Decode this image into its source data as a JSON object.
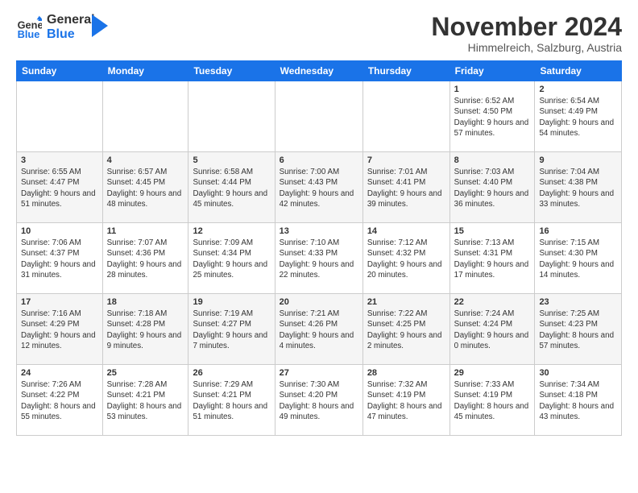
{
  "logo": {
    "line1": "General",
    "line2": "Blue"
  },
  "title": "November 2024",
  "location": "Himmelreich, Salzburg, Austria",
  "weekdays": [
    "Sunday",
    "Monday",
    "Tuesday",
    "Wednesday",
    "Thursday",
    "Friday",
    "Saturday"
  ],
  "weeks": [
    [
      {
        "day": "",
        "info": ""
      },
      {
        "day": "",
        "info": ""
      },
      {
        "day": "",
        "info": ""
      },
      {
        "day": "",
        "info": ""
      },
      {
        "day": "",
        "info": ""
      },
      {
        "day": "1",
        "info": "Sunrise: 6:52 AM\nSunset: 4:50 PM\nDaylight: 9 hours and 57 minutes."
      },
      {
        "day": "2",
        "info": "Sunrise: 6:54 AM\nSunset: 4:49 PM\nDaylight: 9 hours and 54 minutes."
      }
    ],
    [
      {
        "day": "3",
        "info": "Sunrise: 6:55 AM\nSunset: 4:47 PM\nDaylight: 9 hours and 51 minutes."
      },
      {
        "day": "4",
        "info": "Sunrise: 6:57 AM\nSunset: 4:45 PM\nDaylight: 9 hours and 48 minutes."
      },
      {
        "day": "5",
        "info": "Sunrise: 6:58 AM\nSunset: 4:44 PM\nDaylight: 9 hours and 45 minutes."
      },
      {
        "day": "6",
        "info": "Sunrise: 7:00 AM\nSunset: 4:43 PM\nDaylight: 9 hours and 42 minutes."
      },
      {
        "day": "7",
        "info": "Sunrise: 7:01 AM\nSunset: 4:41 PM\nDaylight: 9 hours and 39 minutes."
      },
      {
        "day": "8",
        "info": "Sunrise: 7:03 AM\nSunset: 4:40 PM\nDaylight: 9 hours and 36 minutes."
      },
      {
        "day": "9",
        "info": "Sunrise: 7:04 AM\nSunset: 4:38 PM\nDaylight: 9 hours and 33 minutes."
      }
    ],
    [
      {
        "day": "10",
        "info": "Sunrise: 7:06 AM\nSunset: 4:37 PM\nDaylight: 9 hours and 31 minutes."
      },
      {
        "day": "11",
        "info": "Sunrise: 7:07 AM\nSunset: 4:36 PM\nDaylight: 9 hours and 28 minutes."
      },
      {
        "day": "12",
        "info": "Sunrise: 7:09 AM\nSunset: 4:34 PM\nDaylight: 9 hours and 25 minutes."
      },
      {
        "day": "13",
        "info": "Sunrise: 7:10 AM\nSunset: 4:33 PM\nDaylight: 9 hours and 22 minutes."
      },
      {
        "day": "14",
        "info": "Sunrise: 7:12 AM\nSunset: 4:32 PM\nDaylight: 9 hours and 20 minutes."
      },
      {
        "day": "15",
        "info": "Sunrise: 7:13 AM\nSunset: 4:31 PM\nDaylight: 9 hours and 17 minutes."
      },
      {
        "day": "16",
        "info": "Sunrise: 7:15 AM\nSunset: 4:30 PM\nDaylight: 9 hours and 14 minutes."
      }
    ],
    [
      {
        "day": "17",
        "info": "Sunrise: 7:16 AM\nSunset: 4:29 PM\nDaylight: 9 hours and 12 minutes."
      },
      {
        "day": "18",
        "info": "Sunrise: 7:18 AM\nSunset: 4:28 PM\nDaylight: 9 hours and 9 minutes."
      },
      {
        "day": "19",
        "info": "Sunrise: 7:19 AM\nSunset: 4:27 PM\nDaylight: 9 hours and 7 minutes."
      },
      {
        "day": "20",
        "info": "Sunrise: 7:21 AM\nSunset: 4:26 PM\nDaylight: 9 hours and 4 minutes."
      },
      {
        "day": "21",
        "info": "Sunrise: 7:22 AM\nSunset: 4:25 PM\nDaylight: 9 hours and 2 minutes."
      },
      {
        "day": "22",
        "info": "Sunrise: 7:24 AM\nSunset: 4:24 PM\nDaylight: 9 hours and 0 minutes."
      },
      {
        "day": "23",
        "info": "Sunrise: 7:25 AM\nSunset: 4:23 PM\nDaylight: 8 hours and 57 minutes."
      }
    ],
    [
      {
        "day": "24",
        "info": "Sunrise: 7:26 AM\nSunset: 4:22 PM\nDaylight: 8 hours and 55 minutes."
      },
      {
        "day": "25",
        "info": "Sunrise: 7:28 AM\nSunset: 4:21 PM\nDaylight: 8 hours and 53 minutes."
      },
      {
        "day": "26",
        "info": "Sunrise: 7:29 AM\nSunset: 4:21 PM\nDaylight: 8 hours and 51 minutes."
      },
      {
        "day": "27",
        "info": "Sunrise: 7:30 AM\nSunset: 4:20 PM\nDaylight: 8 hours and 49 minutes."
      },
      {
        "day": "28",
        "info": "Sunrise: 7:32 AM\nSunset: 4:19 PM\nDaylight: 8 hours and 47 minutes."
      },
      {
        "day": "29",
        "info": "Sunrise: 7:33 AM\nSunset: 4:19 PM\nDaylight: 8 hours and 45 minutes."
      },
      {
        "day": "30",
        "info": "Sunrise: 7:34 AM\nSunset: 4:18 PM\nDaylight: 8 hours and 43 minutes."
      }
    ]
  ]
}
